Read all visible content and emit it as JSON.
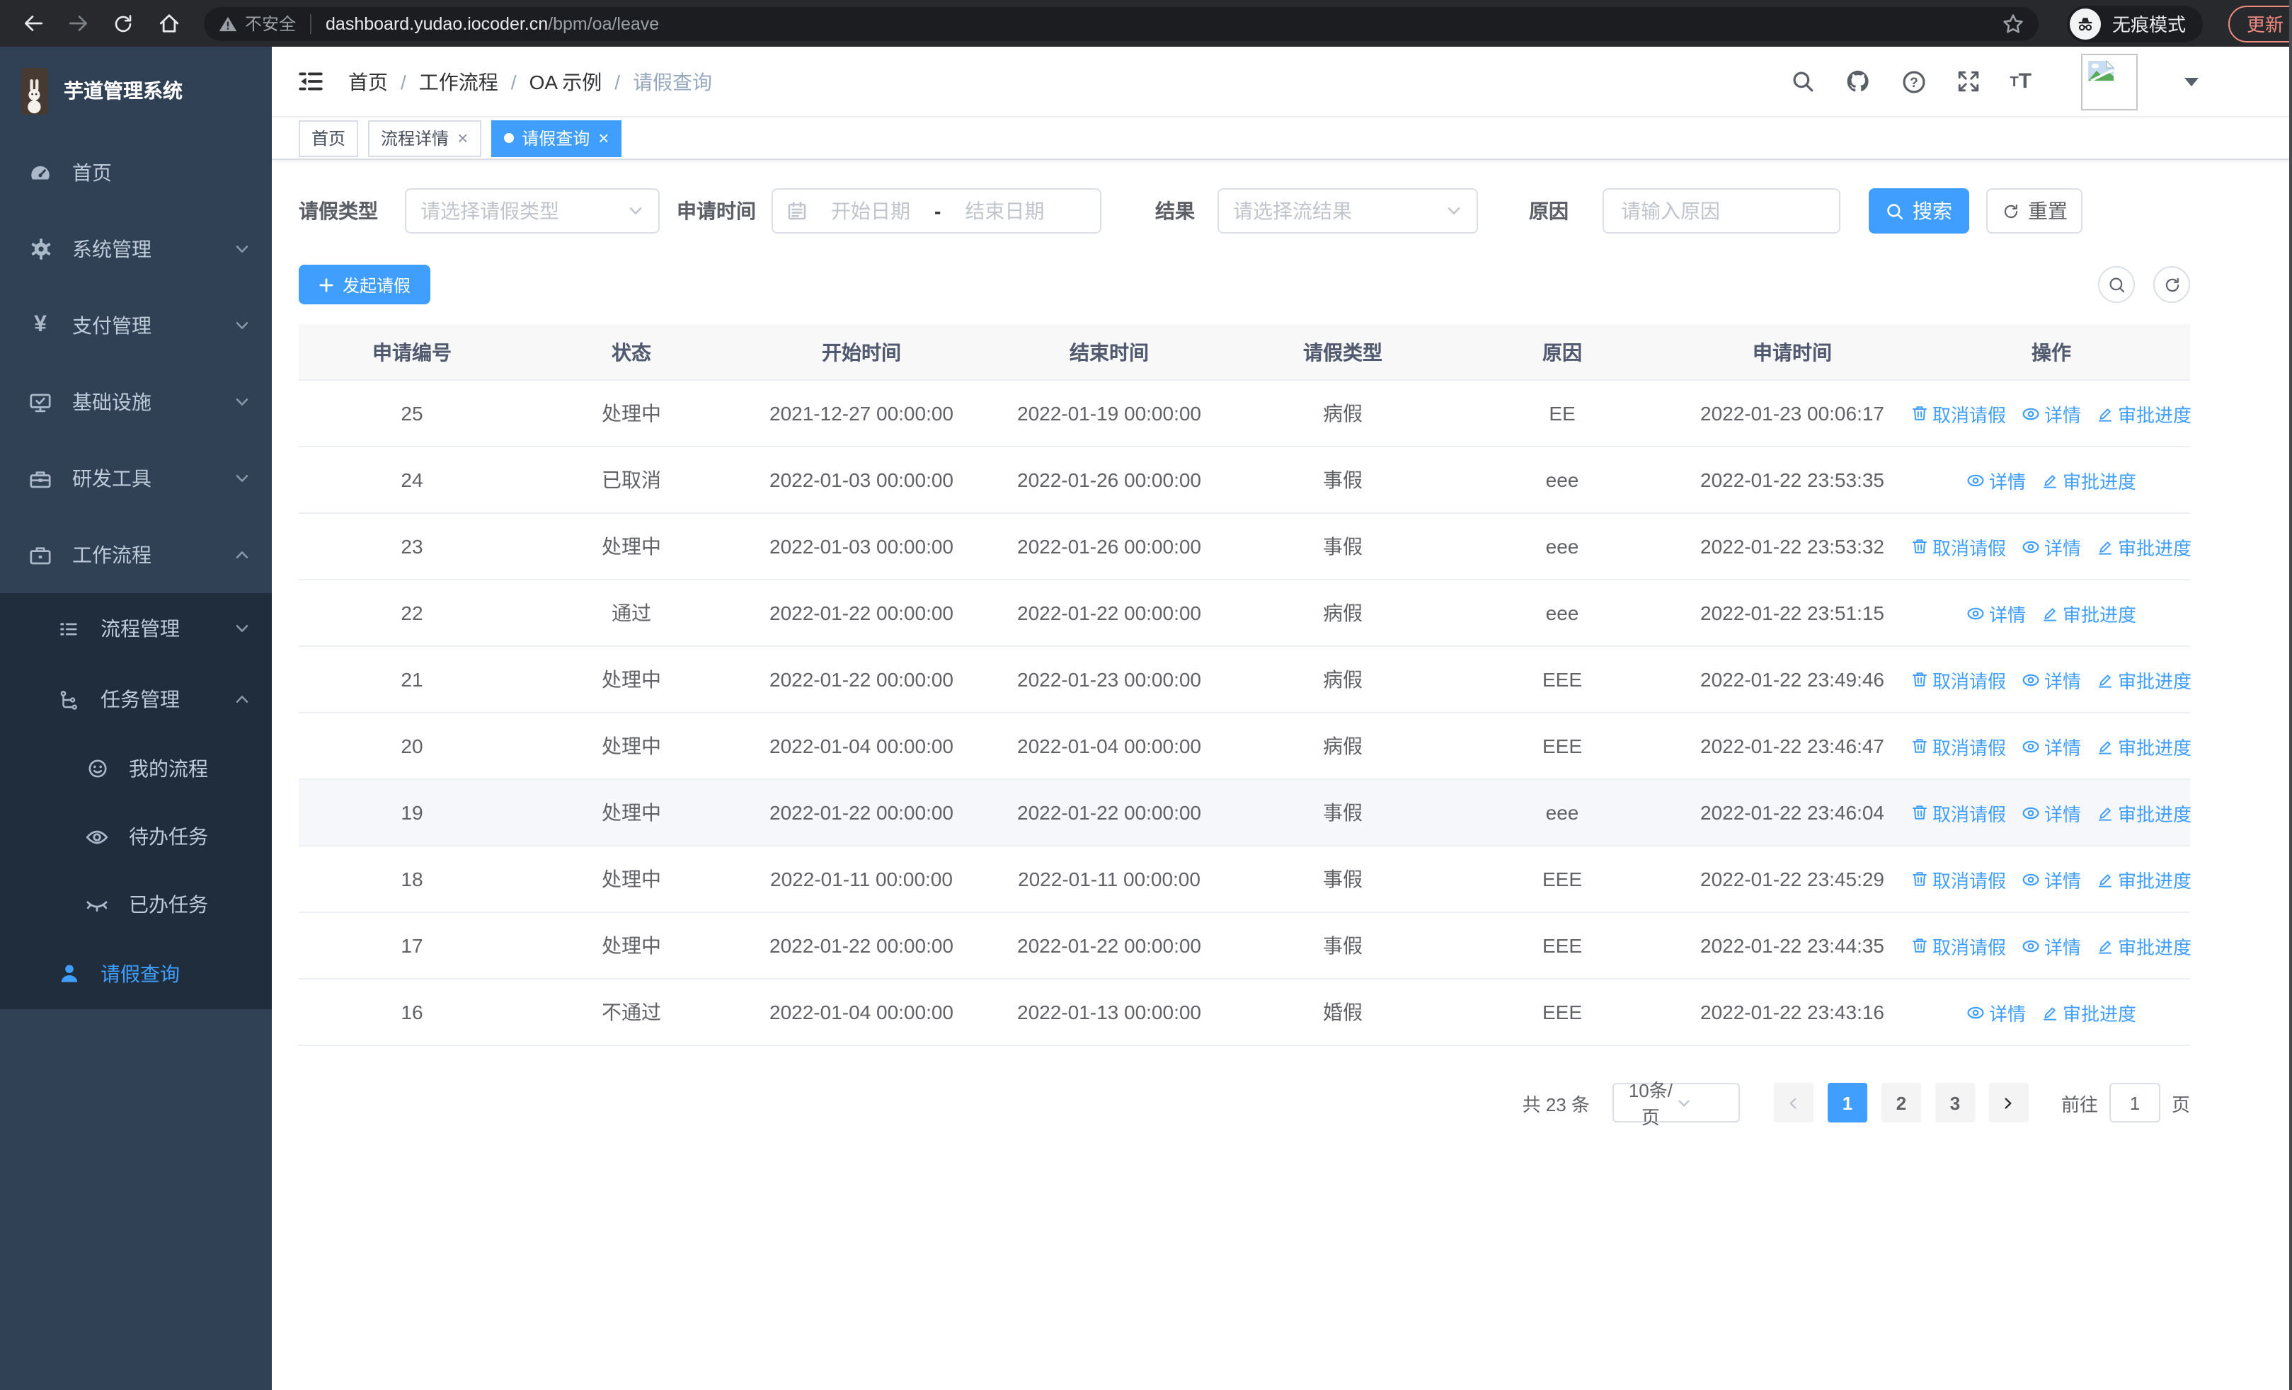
{
  "colors": {
    "accent": "#409eff",
    "sidebar_bg": "#304156",
    "submenu_bg": "#1f2d3d",
    "danger": "#f28b82"
  },
  "browser": {
    "security_label": "不安全",
    "url_host": "dashboard.yudao.iocoder.cn",
    "url_path": "/bpm/oa/leave",
    "incognito_label": "无痕模式",
    "update_label": "更新"
  },
  "sidebar": {
    "app_title": "芋道管理系统",
    "items": [
      {
        "label": "首页"
      },
      {
        "label": "系统管理"
      },
      {
        "label": "支付管理"
      },
      {
        "label": "基础设施"
      },
      {
        "label": "研发工具"
      },
      {
        "label": "工作流程"
      },
      {
        "label": "流程管理"
      },
      {
        "label": "任务管理"
      },
      {
        "label": "我的流程"
      },
      {
        "label": "待办任务"
      },
      {
        "label": "已办任务"
      },
      {
        "label": "请假查询"
      }
    ]
  },
  "header": {
    "breadcrumb": [
      "首页",
      "工作流程",
      "OA 示例",
      "请假查询"
    ]
  },
  "tabs": [
    {
      "label": "首页"
    },
    {
      "label": "流程详情"
    },
    {
      "label": "请假查询"
    }
  ],
  "filters": {
    "leave_type": {
      "label": "请假类型",
      "placeholder": "请选择请假类型"
    },
    "apply_time": {
      "label": "申请时间",
      "start_placeholder": "开始日期",
      "separator": "-",
      "end_placeholder": "结束日期"
    },
    "result": {
      "label": "结果",
      "placeholder": "请选择流结果"
    },
    "reason": {
      "label": "原因",
      "placeholder": "请输入原因"
    },
    "search_label": "搜索",
    "reset_label": "重置"
  },
  "toolbar": {
    "create_label": "发起请假"
  },
  "table": {
    "columns": [
      "申请编号",
      "状态",
      "开始时间",
      "结束时间",
      "请假类型",
      "原因",
      "申请时间",
      "操作"
    ],
    "rows": [
      {
        "id": "25",
        "status": "处理中",
        "start": "2021-12-27 00:00:00",
        "end": "2022-01-19 00:00:00",
        "type": "病假",
        "reason": "EE",
        "apply_time": "2022-01-23 00:06:17"
      },
      {
        "id": "24",
        "status": "已取消",
        "start": "2022-01-03 00:00:00",
        "end": "2022-01-26 00:00:00",
        "type": "事假",
        "reason": "eee",
        "apply_time": "2022-01-22 23:53:35"
      },
      {
        "id": "23",
        "status": "处理中",
        "start": "2022-01-03 00:00:00",
        "end": "2022-01-26 00:00:00",
        "type": "事假",
        "reason": "eee",
        "apply_time": "2022-01-22 23:53:32"
      },
      {
        "id": "22",
        "status": "通过",
        "start": "2022-01-22 00:00:00",
        "end": "2022-01-22 00:00:00",
        "type": "病假",
        "reason": "eee",
        "apply_time": "2022-01-22 23:51:15"
      },
      {
        "id": "21",
        "status": "处理中",
        "start": "2022-01-22 00:00:00",
        "end": "2022-01-23 00:00:00",
        "type": "病假",
        "reason": "EEE",
        "apply_time": "2022-01-22 23:49:46"
      },
      {
        "id": "20",
        "status": "处理中",
        "start": "2022-01-04 00:00:00",
        "end": "2022-01-04 00:00:00",
        "type": "病假",
        "reason": "EEE",
        "apply_time": "2022-01-22 23:46:47"
      },
      {
        "id": "19",
        "status": "处理中",
        "start": "2022-01-22 00:00:00",
        "end": "2022-01-22 00:00:00",
        "type": "事假",
        "reason": "eee",
        "apply_time": "2022-01-22 23:46:04"
      },
      {
        "id": "18",
        "status": "处理中",
        "start": "2022-01-11 00:00:00",
        "end": "2022-01-11 00:00:00",
        "type": "事假",
        "reason": "EEE",
        "apply_time": "2022-01-22 23:45:29"
      },
      {
        "id": "17",
        "status": "处理中",
        "start": "2022-01-22 00:00:00",
        "end": "2022-01-22 00:00:00",
        "type": "事假",
        "reason": "EEE",
        "apply_time": "2022-01-22 23:44:35"
      },
      {
        "id": "16",
        "status": "不通过",
        "start": "2022-01-04 00:00:00",
        "end": "2022-01-13 00:00:00",
        "type": "婚假",
        "reason": "EEE",
        "apply_time": "2022-01-22 23:43:16"
      }
    ]
  },
  "ops": {
    "cancel": "取消请假",
    "detail": "详情",
    "progress": "审批进度"
  },
  "pagination": {
    "total": "共 23 条",
    "page_size": "10条/页",
    "pages": [
      "1",
      "2",
      "3"
    ],
    "active_page": "1",
    "goto": "前往",
    "goto_value": "1",
    "unit": "页"
  }
}
